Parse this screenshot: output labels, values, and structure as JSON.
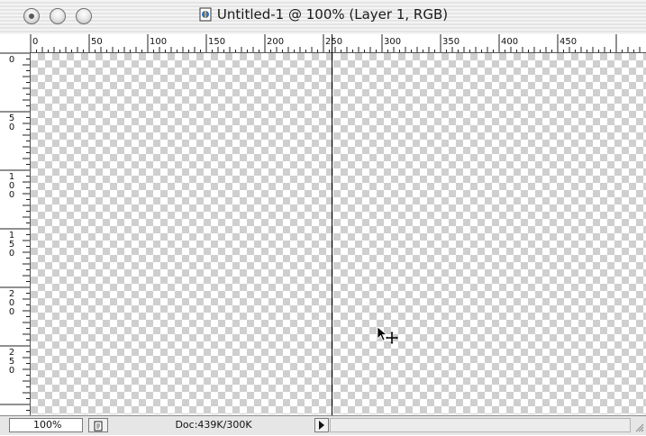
{
  "window": {
    "title": "Untitled-1 @ 100% (Layer 1, RGB)",
    "traffic_lights": [
      "close-button",
      "minimize-button",
      "zoom-button"
    ]
  },
  "rulers": {
    "top_labels": [
      "0",
      "50",
      "100",
      "150",
      "200",
      "250",
      "300",
      "350",
      "400",
      "450"
    ],
    "left_labels": [
      "0",
      "50",
      "100",
      "150",
      "200",
      "250"
    ]
  },
  "statusbar": {
    "zoom": "100%",
    "doc_info": "Doc:439K/300K"
  },
  "icons": {
    "document": "document-icon",
    "move_cursor": "move-tool-cursor-icon",
    "menu_arrow": "triangle-right-icon",
    "grow": "resize-grip-icon"
  }
}
